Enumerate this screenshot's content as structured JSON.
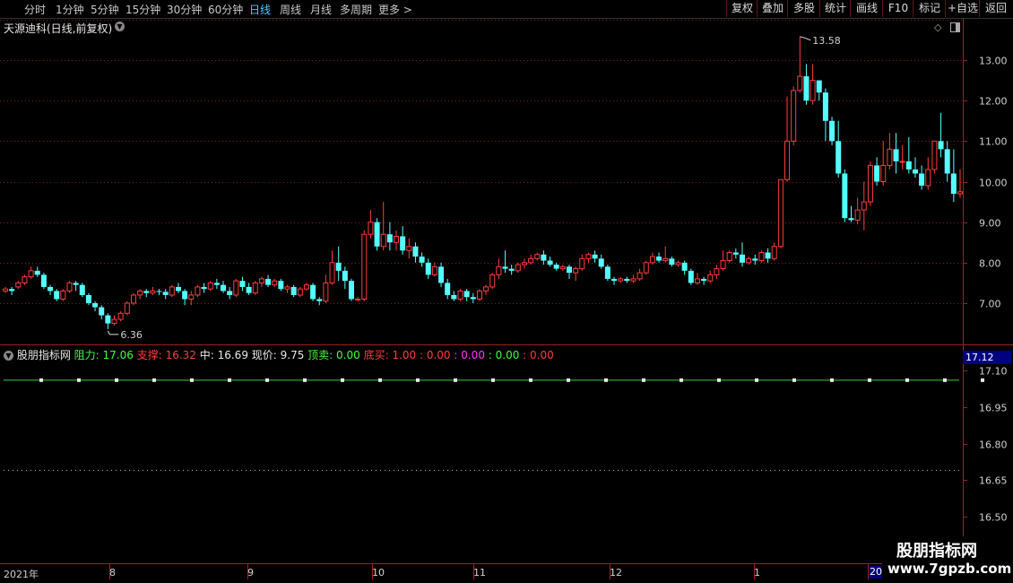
{
  "toolbar": {
    "periods": [
      "分时",
      "1分钟",
      "5分钟",
      "15分钟",
      "30分钟",
      "60分钟",
      "日线",
      "周线",
      "月线",
      "多周期",
      "更多 >"
    ],
    "active_period": "日线",
    "buttons": [
      "复权",
      "叠加",
      "多股",
      "统计",
      "画线",
      "F10",
      "标记",
      "+自选",
      "返回"
    ]
  },
  "chart": {
    "title": "天源迪科(日线,前复权)",
    "max_label": "13.58",
    "min_label": "6.36",
    "price_axis": [
      "13.00",
      "12.00",
      "11.00",
      "10.00",
      "9.00",
      "8.00",
      "7.00"
    ],
    "up_color": "#ff3c3c",
    "down_color": "#54ffff"
  },
  "chart_data": {
    "type": "candlestick",
    "title": "天源迪科(日线,前复权)",
    "ylim": [
      6.3,
      13.7
    ],
    "y_ticks": [
      13,
      12,
      11,
      10,
      9,
      8,
      7
    ],
    "x_month_labels": [
      "2021年",
      "8",
      "9",
      "10",
      "11",
      "12",
      "1",
      "20"
    ],
    "annotations": [
      {
        "text": "13.58",
        "value": 13.58
      },
      {
        "text": "6.36",
        "value": 6.36
      }
    ],
    "candles": [
      [
        7.3,
        7.35,
        7.25,
        7.4
      ],
      [
        7.35,
        7.3,
        7.2,
        7.4
      ],
      [
        7.4,
        7.5,
        7.35,
        7.55
      ],
      [
        7.5,
        7.65,
        7.45,
        7.7
      ],
      [
        7.65,
        7.8,
        7.6,
        7.9
      ],
      [
        7.8,
        7.7,
        7.65,
        7.9
      ],
      [
        7.7,
        7.4,
        7.35,
        7.75
      ],
      [
        7.4,
        7.3,
        7.2,
        7.45
      ],
      [
        7.3,
        7.1,
        7.05,
        7.35
      ],
      [
        7.1,
        7.3,
        7.05,
        7.35
      ],
      [
        7.3,
        7.5,
        7.25,
        7.55
      ],
      [
        7.5,
        7.45,
        7.3,
        7.55
      ],
      [
        7.45,
        7.2,
        7.15,
        7.5
      ],
      [
        7.2,
        7.0,
        6.95,
        7.25
      ],
      [
        7.0,
        6.9,
        6.8,
        7.05
      ],
      [
        6.9,
        6.7,
        6.6,
        6.95
      ],
      [
        6.7,
        6.5,
        6.36,
        6.75
      ],
      [
        6.5,
        6.6,
        6.45,
        6.7
      ],
      [
        6.6,
        6.75,
        6.55,
        6.8
      ],
      [
        6.75,
        7.0,
        6.7,
        7.05
      ],
      [
        7.0,
        7.2,
        6.95,
        7.25
      ],
      [
        7.2,
        7.3,
        7.1,
        7.35
      ],
      [
        7.3,
        7.25,
        7.15,
        7.35
      ],
      [
        7.25,
        7.3,
        7.2,
        7.4
      ],
      [
        7.3,
        7.28,
        7.2,
        7.35
      ],
      [
        7.28,
        7.2,
        7.1,
        7.35
      ],
      [
        7.2,
        7.4,
        7.15,
        7.45
      ],
      [
        7.4,
        7.3,
        7.25,
        7.5
      ],
      [
        7.3,
        7.1,
        6.95,
        7.35
      ],
      [
        7.1,
        7.2,
        6.95,
        7.3
      ],
      [
        7.2,
        7.4,
        7.15,
        7.45
      ],
      [
        7.4,
        7.35,
        7.25,
        7.5
      ],
      [
        7.35,
        7.5,
        7.3,
        7.55
      ],
      [
        7.5,
        7.45,
        7.35,
        7.6
      ],
      [
        7.45,
        7.3,
        7.25,
        7.55
      ],
      [
        7.3,
        7.2,
        7.1,
        7.4
      ],
      [
        7.2,
        7.55,
        7.15,
        7.6
      ],
      [
        7.55,
        7.4,
        7.3,
        7.65
      ],
      [
        7.4,
        7.25,
        7.2,
        7.5
      ],
      [
        7.25,
        7.5,
        7.2,
        7.55
      ],
      [
        7.5,
        7.6,
        7.4,
        7.65
      ],
      [
        7.6,
        7.45,
        7.4,
        7.7
      ],
      [
        7.45,
        7.55,
        7.4,
        7.6
      ],
      [
        7.55,
        7.35,
        7.3,
        7.6
      ],
      [
        7.35,
        7.4,
        7.25,
        7.45
      ],
      [
        7.4,
        7.2,
        7.15,
        7.45
      ],
      [
        7.2,
        7.35,
        7.15,
        7.4
      ],
      [
        7.35,
        7.45,
        7.3,
        7.5
      ],
      [
        7.45,
        7.1,
        7.05,
        7.5
      ],
      [
        7.1,
        7.05,
        6.95,
        7.15
      ],
      [
        7.05,
        7.5,
        7.0,
        7.7
      ],
      [
        7.5,
        8.0,
        7.45,
        8.3
      ],
      [
        8.0,
        7.8,
        7.55,
        8.4
      ],
      [
        7.8,
        7.55,
        7.35,
        7.9
      ],
      [
        7.55,
        7.1,
        7.05,
        7.6
      ],
      [
        7.1,
        7.1,
        7.05,
        7.15
      ],
      [
        7.1,
        8.7,
        7.05,
        8.8
      ],
      [
        8.7,
        9.0,
        8.6,
        9.3
      ],
      [
        9.0,
        8.4,
        8.3,
        9.1
      ],
      [
        8.4,
        8.7,
        8.3,
        9.5
      ],
      [
        8.7,
        8.5,
        8.3,
        9.0
      ],
      [
        8.5,
        8.65,
        8.3,
        8.8
      ],
      [
        8.65,
        8.3,
        8.2,
        8.9
      ],
      [
        8.3,
        8.4,
        8.1,
        8.6
      ],
      [
        8.4,
        8.15,
        8.0,
        8.5
      ],
      [
        8.15,
        8.0,
        7.9,
        8.25
      ],
      [
        8.0,
        7.7,
        7.6,
        8.1
      ],
      [
        7.7,
        7.9,
        7.65,
        8.0
      ],
      [
        7.9,
        7.5,
        7.4,
        8.0
      ],
      [
        7.5,
        7.2,
        7.1,
        7.6
      ],
      [
        7.2,
        7.1,
        7.05,
        7.3
      ],
      [
        7.1,
        7.3,
        7.05,
        7.35
      ],
      [
        7.3,
        7.15,
        7.05,
        7.35
      ],
      [
        7.15,
        7.1,
        7.0,
        7.25
      ],
      [
        7.1,
        7.3,
        7.05,
        7.35
      ],
      [
        7.3,
        7.4,
        7.2,
        7.45
      ],
      [
        7.4,
        7.7,
        7.35,
        7.75
      ],
      [
        7.7,
        7.9,
        7.6,
        8.1
      ],
      [
        7.9,
        7.85,
        7.75,
        8.3
      ],
      [
        7.85,
        7.8,
        7.7,
        7.95
      ],
      [
        7.8,
        7.95,
        7.75,
        8.0
      ],
      [
        7.95,
        8.0,
        7.85,
        8.1
      ],
      [
        8.0,
        8.1,
        7.95,
        8.2
      ],
      [
        8.1,
        8.2,
        8.05,
        8.25
      ],
      [
        8.2,
        8.05,
        7.95,
        8.3
      ],
      [
        8.05,
        7.95,
        7.9,
        8.15
      ],
      [
        7.95,
        7.85,
        7.8,
        8.0
      ],
      [
        7.85,
        7.9,
        7.8,
        7.95
      ],
      [
        7.9,
        7.75,
        7.6,
        7.95
      ],
      [
        7.75,
        7.85,
        7.55,
        7.9
      ],
      [
        7.85,
        8.1,
        7.8,
        8.2
      ],
      [
        8.1,
        8.2,
        8.0,
        8.25
      ],
      [
        8.2,
        8.1,
        8.0,
        8.3
      ],
      [
        8.1,
        7.9,
        7.85,
        8.2
      ],
      [
        7.9,
        7.6,
        7.55,
        7.95
      ],
      [
        7.6,
        7.55,
        7.45,
        7.65
      ],
      [
        7.55,
        7.6,
        7.5,
        7.65
      ],
      [
        7.6,
        7.55,
        7.5,
        7.65
      ],
      [
        7.55,
        7.6,
        7.5,
        7.7
      ],
      [
        7.6,
        7.75,
        7.55,
        7.85
      ],
      [
        7.75,
        8.0,
        7.7,
        8.05
      ],
      [
        8.0,
        8.15,
        7.95,
        8.25
      ],
      [
        8.15,
        8.05,
        8.0,
        8.25
      ],
      [
        8.05,
        8.1,
        8.0,
        8.4
      ],
      [
        8.1,
        7.95,
        7.9,
        8.15
      ],
      [
        7.95,
        8.0,
        7.9,
        8.05
      ],
      [
        8.0,
        7.8,
        7.7,
        8.05
      ],
      [
        7.8,
        7.5,
        7.45,
        7.85
      ],
      [
        7.5,
        7.6,
        7.45,
        7.75
      ],
      [
        7.6,
        7.55,
        7.45,
        7.65
      ],
      [
        7.55,
        7.7,
        7.5,
        7.8
      ],
      [
        7.7,
        7.85,
        7.6,
        7.95
      ],
      [
        7.85,
        8.05,
        7.8,
        8.3
      ],
      [
        8.05,
        8.25,
        8.0,
        8.3
      ],
      [
        8.25,
        8.2,
        8.1,
        8.35
      ],
      [
        8.2,
        8.0,
        7.9,
        8.5
      ],
      [
        8.0,
        8.1,
        7.95,
        8.15
      ],
      [
        8.1,
        8.05,
        7.95,
        8.2
      ],
      [
        8.05,
        8.25,
        8.0,
        8.3
      ],
      [
        8.25,
        8.1,
        8.0,
        8.35
      ],
      [
        8.1,
        8.4,
        8.05,
        8.5
      ],
      [
        8.4,
        10.05,
        8.35,
        10.05
      ],
      [
        10.05,
        11.0,
        10.0,
        12.1
      ],
      [
        11.0,
        12.25,
        10.9,
        12.35
      ],
      [
        12.25,
        12.6,
        12.2,
        13.58
      ],
      [
        12.6,
        12.0,
        11.9,
        12.9
      ],
      [
        12.0,
        12.5,
        11.9,
        12.9
      ],
      [
        12.5,
        12.2,
        12.0,
        12.5
      ],
      [
        12.2,
        11.5,
        11.0,
        12.3
      ],
      [
        11.5,
        11.0,
        10.9,
        11.6
      ],
      [
        11.0,
        10.2,
        10.1,
        11.5
      ],
      [
        10.2,
        9.1,
        9.0,
        10.3
      ],
      [
        9.1,
        9.05,
        9.0,
        9.4
      ],
      [
        9.05,
        9.3,
        8.95,
        9.6
      ],
      [
        9.3,
        9.5,
        8.8,
        10.0
      ],
      [
        9.5,
        10.4,
        9.4,
        10.5
      ],
      [
        10.4,
        10.0,
        9.9,
        10.6
      ],
      [
        10.0,
        10.4,
        9.9,
        11.0
      ],
      [
        10.4,
        10.8,
        10.3,
        11.2
      ],
      [
        10.8,
        10.5,
        10.2,
        11.2
      ],
      [
        10.5,
        10.5,
        10.3,
        10.9
      ],
      [
        10.5,
        10.3,
        10.2,
        11.1
      ],
      [
        10.3,
        10.2,
        10.1,
        10.6
      ],
      [
        10.2,
        9.9,
        9.8,
        10.4
      ],
      [
        9.9,
        10.3,
        9.8,
        10.6
      ],
      [
        10.3,
        11.0,
        10.2,
        11.0
      ],
      [
        11.0,
        10.8,
        10.6,
        11.7
      ],
      [
        10.8,
        10.2,
        10.0,
        11.0
      ],
      [
        10.2,
        9.7,
        9.5,
        10.8
      ],
      [
        9.7,
        9.75,
        9.6,
        10.3
      ]
    ]
  },
  "indicator": {
    "name": "股朋指标网",
    "items": [
      {
        "text": "阻力: 17.06",
        "color": "#3dff3d"
      },
      {
        "text": "支撑: 16.32",
        "color": "#ff3c3c"
      },
      {
        "text": "中: 16.69",
        "color": "#e8e8e8"
      },
      {
        "text": "现价: 9.75",
        "color": "#e8e8e8"
      },
      {
        "text": "顶卖: 0.00",
        "color": "#3dff3d"
      },
      {
        "text": "底买: 1.00",
        "color": "#ff3c3c"
      },
      {
        "text": ": 0.00",
        "color": "#ff3c3c"
      },
      {
        "text": ": 0.00",
        "color": "#ff33ff"
      },
      {
        "text": ": 0.00",
        "color": "#3dff3d"
      },
      {
        "text": ": 0.00",
        "color": "#ff3c3c"
      }
    ],
    "current_value_box": "17.12",
    "axis": [
      "17.10",
      "16.95",
      "16.80",
      "16.65",
      "16.50"
    ],
    "resistance_value": 17.06,
    "support_line_value": 16.69,
    "ylim": [
      16.44,
      17.15
    ]
  },
  "date_axis": [
    "2021年",
    "8",
    "9",
    "10",
    "11",
    "12",
    "1"
  ],
  "date_end_label": "20",
  "watermark": {
    "title": "股朋指标网",
    "url": "www.7gpzb.com"
  }
}
